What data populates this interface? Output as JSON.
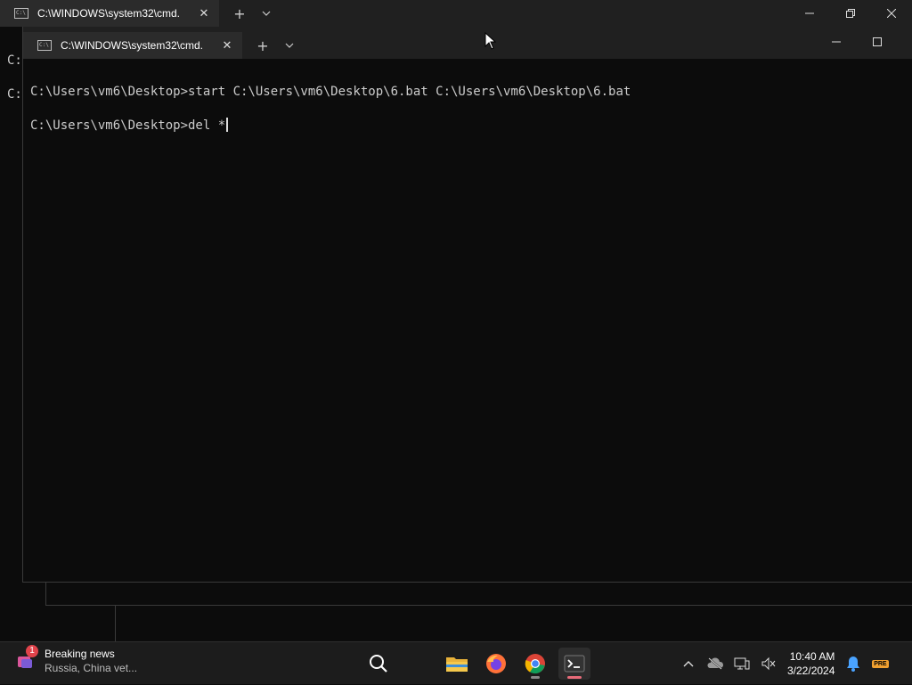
{
  "back_window": {
    "tab_title": "C:\\WINDOWS\\system32\\cmd.",
    "tab_close": "✕",
    "new_tab": "+",
    "dropdown": "⌄",
    "minimize": "—",
    "restore": "❐",
    "close": "✕",
    "visible_lines": [
      "C:",
      "C:"
    ]
  },
  "front_window": {
    "tab_title": "C:\\WINDOWS\\system32\\cmd.",
    "tab_close": "✕",
    "new_tab": "+",
    "dropdown": "⌄",
    "minimize": "—",
    "maximize": "☐",
    "console_lines": [
      "C:\\Users\\vm6\\Desktop>start C:\\Users\\vm6\\Desktop\\6.bat C:\\Users\\vm6\\Desktop\\6.bat",
      "",
      "C:\\Users\\vm6\\Desktop>del *"
    ]
  },
  "taskbar": {
    "news": {
      "badge": "1",
      "title": "Breaking news",
      "subtitle": "Russia, China vet..."
    },
    "apps": [
      {
        "name": "search-icon",
        "label": "Search"
      },
      {
        "name": "file-explorer-icon",
        "label": "File Explorer"
      },
      {
        "name": "firefox-icon",
        "label": "Firefox"
      },
      {
        "name": "chrome-icon",
        "label": "Chrome"
      },
      {
        "name": "terminal-icon",
        "label": "Terminal"
      }
    ],
    "tray": {
      "chevron": "^",
      "time": "10:40 AM",
      "date": "3/22/2024",
      "badge": "PRE"
    }
  },
  "colors": {
    "console_bg": "#0c0c0c",
    "console_text": "#cccccc",
    "tab_bg": "#2b2b2b",
    "titlebar_bg": "#202020",
    "taskbar_bg": "#1c1c1c",
    "accent_pink": "#e86b79",
    "notification_blue": "#4aa3ff"
  }
}
